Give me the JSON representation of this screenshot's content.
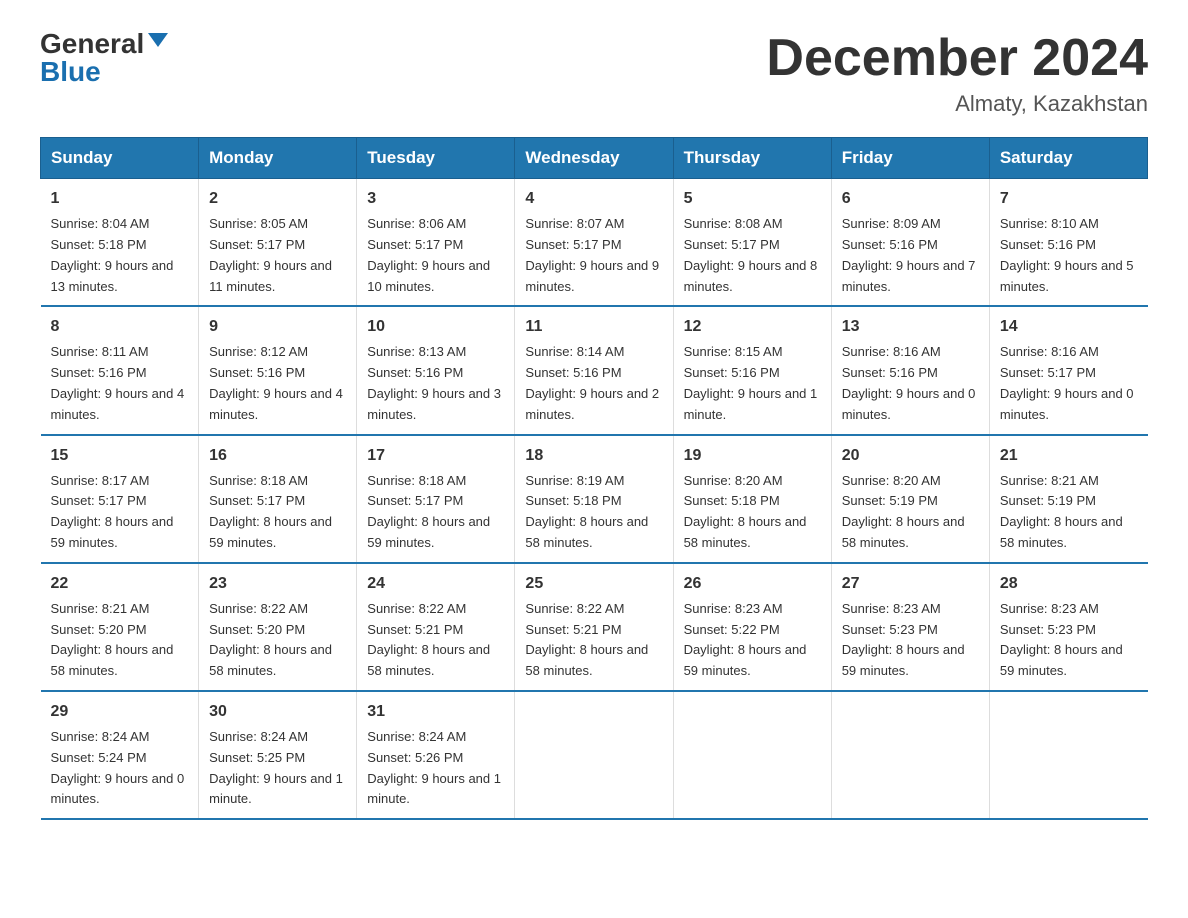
{
  "header": {
    "logo_general": "General",
    "logo_blue": "Blue",
    "title": "December 2024",
    "location": "Almaty, Kazakhstan"
  },
  "days_of_week": [
    "Sunday",
    "Monday",
    "Tuesday",
    "Wednesday",
    "Thursday",
    "Friday",
    "Saturday"
  ],
  "weeks": [
    [
      {
        "day": "1",
        "sunrise": "8:04 AM",
        "sunset": "5:18 PM",
        "daylight": "9 hours and 13 minutes."
      },
      {
        "day": "2",
        "sunrise": "8:05 AM",
        "sunset": "5:17 PM",
        "daylight": "9 hours and 11 minutes."
      },
      {
        "day": "3",
        "sunrise": "8:06 AM",
        "sunset": "5:17 PM",
        "daylight": "9 hours and 10 minutes."
      },
      {
        "day": "4",
        "sunrise": "8:07 AM",
        "sunset": "5:17 PM",
        "daylight": "9 hours and 9 minutes."
      },
      {
        "day": "5",
        "sunrise": "8:08 AM",
        "sunset": "5:17 PM",
        "daylight": "9 hours and 8 minutes."
      },
      {
        "day": "6",
        "sunrise": "8:09 AM",
        "sunset": "5:16 PM",
        "daylight": "9 hours and 7 minutes."
      },
      {
        "day": "7",
        "sunrise": "8:10 AM",
        "sunset": "5:16 PM",
        "daylight": "9 hours and 5 minutes."
      }
    ],
    [
      {
        "day": "8",
        "sunrise": "8:11 AM",
        "sunset": "5:16 PM",
        "daylight": "9 hours and 4 minutes."
      },
      {
        "day": "9",
        "sunrise": "8:12 AM",
        "sunset": "5:16 PM",
        "daylight": "9 hours and 4 minutes."
      },
      {
        "day": "10",
        "sunrise": "8:13 AM",
        "sunset": "5:16 PM",
        "daylight": "9 hours and 3 minutes."
      },
      {
        "day": "11",
        "sunrise": "8:14 AM",
        "sunset": "5:16 PM",
        "daylight": "9 hours and 2 minutes."
      },
      {
        "day": "12",
        "sunrise": "8:15 AM",
        "sunset": "5:16 PM",
        "daylight": "9 hours and 1 minute."
      },
      {
        "day": "13",
        "sunrise": "8:16 AM",
        "sunset": "5:16 PM",
        "daylight": "9 hours and 0 minutes."
      },
      {
        "day": "14",
        "sunrise": "8:16 AM",
        "sunset": "5:17 PM",
        "daylight": "9 hours and 0 minutes."
      }
    ],
    [
      {
        "day": "15",
        "sunrise": "8:17 AM",
        "sunset": "5:17 PM",
        "daylight": "8 hours and 59 minutes."
      },
      {
        "day": "16",
        "sunrise": "8:18 AM",
        "sunset": "5:17 PM",
        "daylight": "8 hours and 59 minutes."
      },
      {
        "day": "17",
        "sunrise": "8:18 AM",
        "sunset": "5:17 PM",
        "daylight": "8 hours and 59 minutes."
      },
      {
        "day": "18",
        "sunrise": "8:19 AM",
        "sunset": "5:18 PM",
        "daylight": "8 hours and 58 minutes."
      },
      {
        "day": "19",
        "sunrise": "8:20 AM",
        "sunset": "5:18 PM",
        "daylight": "8 hours and 58 minutes."
      },
      {
        "day": "20",
        "sunrise": "8:20 AM",
        "sunset": "5:19 PM",
        "daylight": "8 hours and 58 minutes."
      },
      {
        "day": "21",
        "sunrise": "8:21 AM",
        "sunset": "5:19 PM",
        "daylight": "8 hours and 58 minutes."
      }
    ],
    [
      {
        "day": "22",
        "sunrise": "8:21 AM",
        "sunset": "5:20 PM",
        "daylight": "8 hours and 58 minutes."
      },
      {
        "day": "23",
        "sunrise": "8:22 AM",
        "sunset": "5:20 PM",
        "daylight": "8 hours and 58 minutes."
      },
      {
        "day": "24",
        "sunrise": "8:22 AM",
        "sunset": "5:21 PM",
        "daylight": "8 hours and 58 minutes."
      },
      {
        "day": "25",
        "sunrise": "8:22 AM",
        "sunset": "5:21 PM",
        "daylight": "8 hours and 58 minutes."
      },
      {
        "day": "26",
        "sunrise": "8:23 AM",
        "sunset": "5:22 PM",
        "daylight": "8 hours and 59 minutes."
      },
      {
        "day": "27",
        "sunrise": "8:23 AM",
        "sunset": "5:23 PM",
        "daylight": "8 hours and 59 minutes."
      },
      {
        "day": "28",
        "sunrise": "8:23 AM",
        "sunset": "5:23 PM",
        "daylight": "8 hours and 59 minutes."
      }
    ],
    [
      {
        "day": "29",
        "sunrise": "8:24 AM",
        "sunset": "5:24 PM",
        "daylight": "9 hours and 0 minutes."
      },
      {
        "day": "30",
        "sunrise": "8:24 AM",
        "sunset": "5:25 PM",
        "daylight": "9 hours and 1 minute."
      },
      {
        "day": "31",
        "sunrise": "8:24 AM",
        "sunset": "5:26 PM",
        "daylight": "9 hours and 1 minute."
      },
      null,
      null,
      null,
      null
    ]
  ]
}
